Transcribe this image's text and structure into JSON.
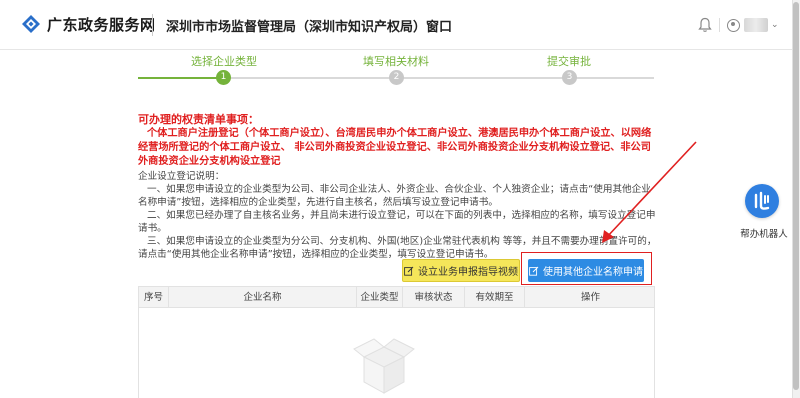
{
  "header": {
    "brand": "广东政务服务网",
    "title": "深圳市市场监督管理局（深圳市知识产权局）窗口"
  },
  "steps": [
    {
      "label": "选择企业类型",
      "number": "1",
      "active": true
    },
    {
      "label": "填写相关材料",
      "number": "2",
      "active": false
    },
    {
      "label": "提交审批",
      "number": "3",
      "active": false
    }
  ],
  "notice": {
    "title": "可办理的权责清单事项：",
    "items_line1": "个体工商户注册登记（个体工商户设立）、台湾居民申办个体工商户设立、港澳居民申办个体工商户设立、以网络经营场所登记的个体工商户设立、 非公司外商投资企业设立登记、非公司外商投资企业分支机构设立登记、非公司外商投资企业分支机构设立登记"
  },
  "description": {
    "heading": "企业设立登记说明：",
    "p1": "一、如果您申请设立的企业类型为公司、非公司企业法人、外资企业、合伙企业、个人独资企业；请点击“使用其他企业名称申请”按钮，选择相应的企业类型，先进行自主核名，然后填写设立登记申请书。",
    "p2": "二、如果您已经办理了自主核名业务，并且尚未进行设立登记，可以在下面的列表中，选择相应的名称，填写设立登记申请书。",
    "p3": "三、如果您申请设立的企业类型为分公司、分支机构、外国(地区)企业常驻代表机构 等等，并且不需要办理前置许可的，请点击“使用其他企业名称申请”按钮，选择相应的企业类型，填写设立登记申请书。"
  },
  "buttons": {
    "guide_label": "设立业务申报指导视频",
    "other_label": "使用其他企业名称申请"
  },
  "table": {
    "columns": [
      "序号",
      "企业名称",
      "企业类型",
      "审核状态",
      "有效期至",
      "操作"
    ]
  },
  "robot": {
    "label": "帮办机器人"
  },
  "colors": {
    "accent_green": "#75b33b",
    "notice_red": "#e01f1f",
    "primary_blue": "#2d8be3",
    "guide_yellow": "#f5e65a"
  }
}
